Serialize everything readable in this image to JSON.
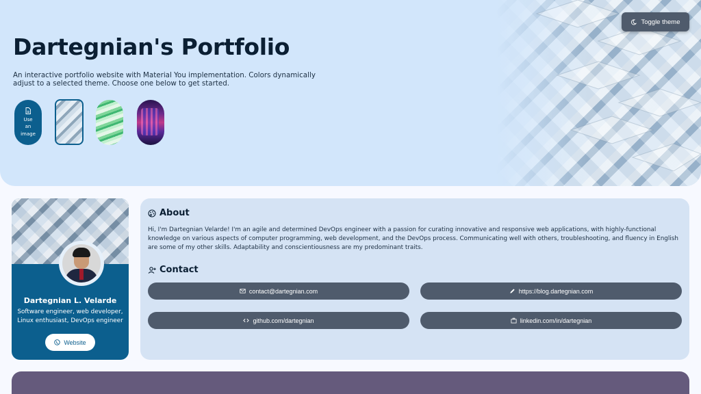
{
  "hero": {
    "title": "Dartegnian's Portfolio",
    "subtitle": "An interactive portfolio website with Material You implementation. Colors dynamically adjust to a selected theme. Choose one below to get started.",
    "toggle_label": "Toggle theme",
    "toggle_icon": "moon-icon",
    "image_chip_label_1": "Use",
    "image_chip_label_2": "an",
    "image_chip_label_3": "image",
    "image_chip_icon": "file-icon"
  },
  "profile": {
    "name": "Dartegnian L. Velarde",
    "description": "Software engineer, web developer, Linux enthusiast, DevOps engineer",
    "website_label": "Website",
    "website_icon": "globe-icon"
  },
  "about": {
    "heading": "About",
    "heading_icon": "palette-icon",
    "text": "Hi, I'm Dartegnian Velarde! I'm an agile and determined DevOps engineer with a passion for curating innovative and responsive web applications, with highly-functional knowledge on various aspects of computer programming, web development, and the DevOps process. Communicating well with others, troubleshooting, and fluency in English are some of my other skills. Adaptability and conscientiousness are my predominant traits."
  },
  "contact": {
    "heading": "Contact",
    "heading_icon": "person-add-icon",
    "email": "contact@dartegnian.com",
    "blog": "https://blog.dartegnian.com",
    "github": "github.com/dartegnian",
    "linkedin": "linkedin.com/in/dartegnian"
  },
  "colors": {
    "primary": "#0c5f8e",
    "hero_bg": "#d2e6fb",
    "card_bg": "#d5e3f4",
    "tonal_button": "#4f5b6c",
    "tertiary": "#655a7c"
  }
}
